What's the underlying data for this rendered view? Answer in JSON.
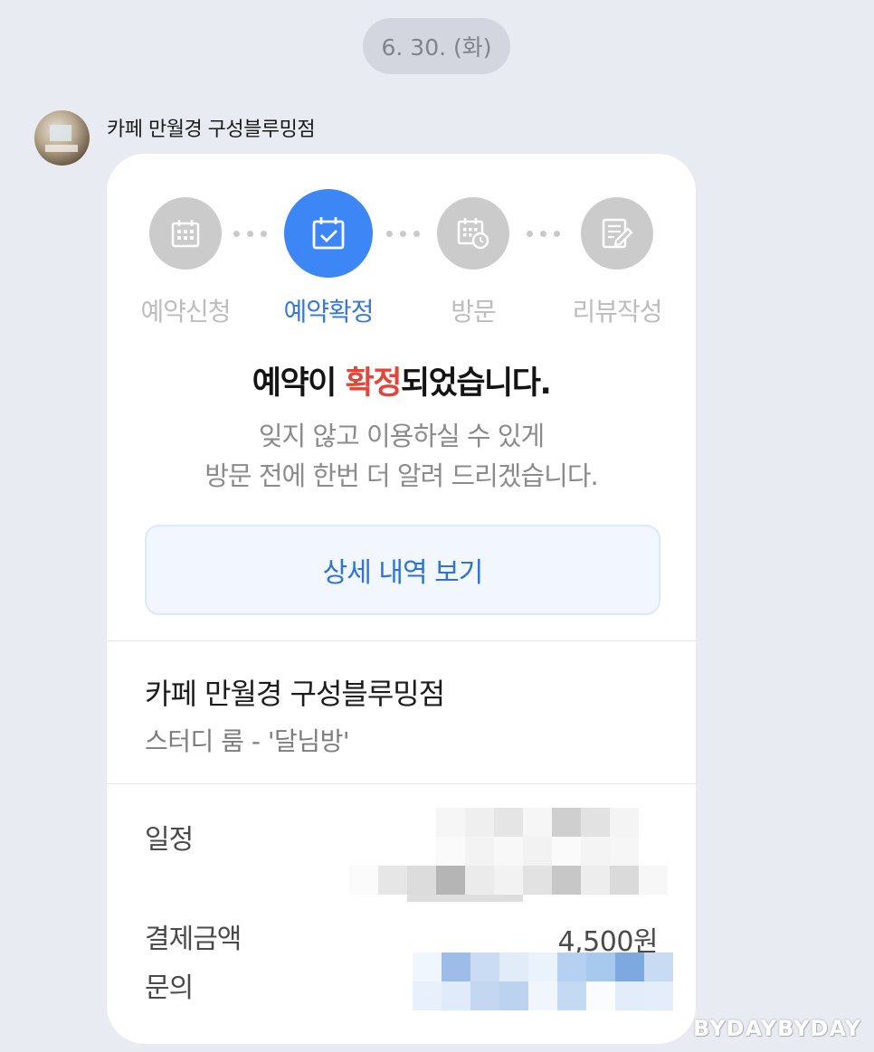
{
  "date_separator": "6. 30. (화)",
  "sender": {
    "name": "카페 만월경 구성블루밍점"
  },
  "steps": [
    {
      "label": "예약신청",
      "icon": "calendar-grid-icon",
      "active": false
    },
    {
      "label": "예약확정",
      "icon": "calendar-check-icon",
      "active": true
    },
    {
      "label": "방문",
      "icon": "calendar-clock-icon",
      "active": false
    },
    {
      "label": "리뷰작성",
      "icon": "review-edit-icon",
      "active": false
    }
  ],
  "headline": {
    "before": "예약이 ",
    "highlight": "확정",
    "after": "되었습니다."
  },
  "subtext": {
    "line1": "잊지 않고 이용하실 수 있게",
    "line2": "방문 전에 한번 더 알려 드리겠습니다."
  },
  "detail_button": {
    "label": "상세 내역 보기"
  },
  "booking": {
    "store_name": "카페 만월경 구성블루밍점",
    "room": "스터디 룸 - '달님방'",
    "schedule_label": "일정",
    "payment_label": "결제금액",
    "payment_amount": "4,500원",
    "inquiry_label": "문의"
  },
  "watermark": "BYDAYBYDAY",
  "colors": {
    "background": "#e8ebf2",
    "accent_blue": "#3d86f5",
    "highlight_red": "#e0463a",
    "inactive_gray": "#cbcbcb"
  }
}
